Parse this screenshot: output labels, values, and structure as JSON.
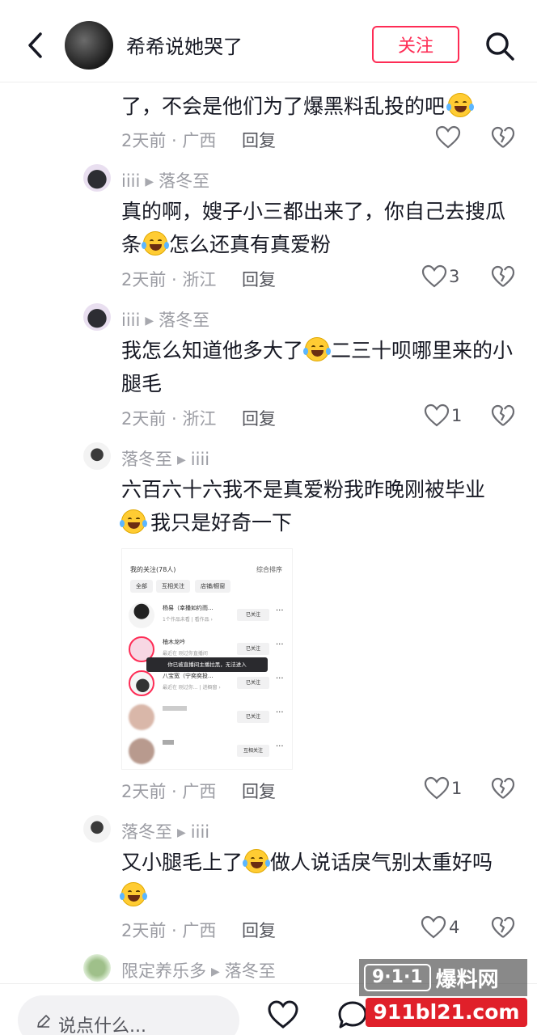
{
  "header": {
    "username": "希希说她哭了",
    "follow_label": "关注"
  },
  "comments": [
    {
      "text1": "了，不会是他们为了爆黑料乱投的吧",
      "meta": "2天前 · 广西",
      "reply": "回复",
      "likes": ""
    },
    {
      "user": "iiii",
      "reply_to": "落冬至",
      "text1": "真的啊，嫂子小三都出来了，你自己去搜瓜",
      "text2": "条",
      "text2b": "怎么还真有真爱粉",
      "meta": "2天前 · 浙江",
      "reply": "回复",
      "likes": "3"
    },
    {
      "user": "iiii",
      "reply_to": "落冬至",
      "text1": "我怎么知道他多大了",
      "text1b": "二三十呗哪里来的小",
      "text2": "腿毛",
      "meta": "2天前 · 浙江",
      "reply": "回复",
      "likes": "1"
    },
    {
      "user": "落冬至",
      "reply_to": "iiii",
      "text1": "六百六十六我不是真爱粉我昨晚刚被毕业",
      "text2": "我只是好奇一下",
      "meta": "2天前 · 广西",
      "reply": "回复",
      "likes": "1"
    },
    {
      "user": "落冬至",
      "reply_to": "iiii",
      "text1": "又小腿毛上了",
      "text1b": "做人说话戾气别太重好吗",
      "meta": "2天前 · 广西",
      "reply": "回复",
      "likes": "4"
    },
    {
      "user": "限定养乐多",
      "reply_to": "落冬至"
    }
  ],
  "screenshot": {
    "title": "我的关注(78人)",
    "sort": "综合排序",
    "chips": [
      "全部",
      "互相关注",
      "店铺/橱窗"
    ],
    "rows": [
      {
        "name": "杨易（幸播如约而...",
        "sub": "1个作品未看 | 看作品 ›",
        "btn": "已关注"
      },
      {
        "name": "柚木龙吟",
        "sub": "最近在 刚过你直播间",
        "btn": "已关注"
      },
      {
        "name": "八宝宽（宁奕奕投...",
        "sub": "最近在 刚过你... | 进橱窗 ›",
        "btn": "已关注"
      },
      {
        "name": "",
        "sub": "",
        "btn": "已关注"
      },
      {
        "name": "",
        "sub": "",
        "btn": "互相关注"
      }
    ],
    "tip": "你已被直播间主播拉黑，无法进入"
  },
  "bottom": {
    "placeholder": "说点什么..."
  },
  "watermark": {
    "badge": "9·1·1",
    "name": "爆料网",
    "url": "911bl21.com"
  }
}
